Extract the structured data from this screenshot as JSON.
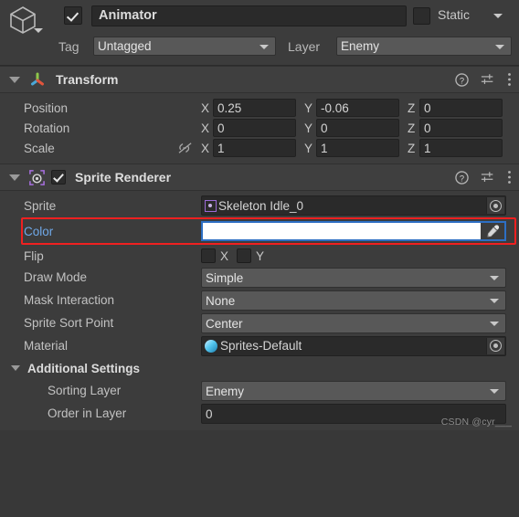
{
  "gameobject": {
    "icon": "cube-icon",
    "enabled": true,
    "name": "Animator",
    "static_label": "Static",
    "static_checked": false,
    "tag_label": "Tag",
    "tag_value": "Untagged",
    "layer_label": "Layer",
    "layer_value": "Enemy"
  },
  "transform": {
    "title": "Transform",
    "icon": "transform-gizmo-icon",
    "expanded": true,
    "help_icon": "help-icon",
    "preset_icon": "preset-sliders-icon",
    "menu_icon": "kebab-menu-icon",
    "rows": [
      {
        "label": "Position",
        "x": "0.25",
        "y": "-0.06",
        "z": "0"
      },
      {
        "label": "Rotation",
        "x": "0",
        "y": "0",
        "z": "0"
      },
      {
        "label": "Scale",
        "x": "1",
        "y": "1",
        "z": "1",
        "constrain_icon": "constrain-proportions-off-icon"
      }
    ],
    "axis_x": "X",
    "axis_y": "Y",
    "axis_z": "Z"
  },
  "sprite_renderer": {
    "title": "Sprite Renderer",
    "icon": "sprite-renderer-icon",
    "enabled": true,
    "expanded": true,
    "help_icon": "help-icon",
    "preset_icon": "preset-sliders-icon",
    "menu_icon": "kebab-menu-icon",
    "sprite": {
      "label": "Sprite",
      "value": "Skeleton Idle_0"
    },
    "color": {
      "label": "Color",
      "value_hex": "#ffffff",
      "highlight_color": "#f02020",
      "focus_border_color": "#2d6fc4",
      "label_color": "#6fa8e8",
      "eyedropper_icon": "eyedropper-icon"
    },
    "flip": {
      "label": "Flip",
      "x_label": "X",
      "y_label": "Y",
      "x_checked": false,
      "y_checked": false
    },
    "draw_mode": {
      "label": "Draw Mode",
      "value": "Simple"
    },
    "mask_interaction": {
      "label": "Mask Interaction",
      "value": "None"
    },
    "sprite_sort_point": {
      "label": "Sprite Sort Point",
      "value": "Center"
    },
    "material": {
      "label": "Material",
      "value": "Sprites-Default"
    },
    "additional_settings": {
      "title": "Additional Settings",
      "expanded": true,
      "sorting_layer": {
        "label": "Sorting Layer",
        "value": "Enemy"
      },
      "order_in_layer": {
        "label": "Order in Layer",
        "value": "0"
      }
    }
  },
  "watermark": "CSDN @cyr___"
}
